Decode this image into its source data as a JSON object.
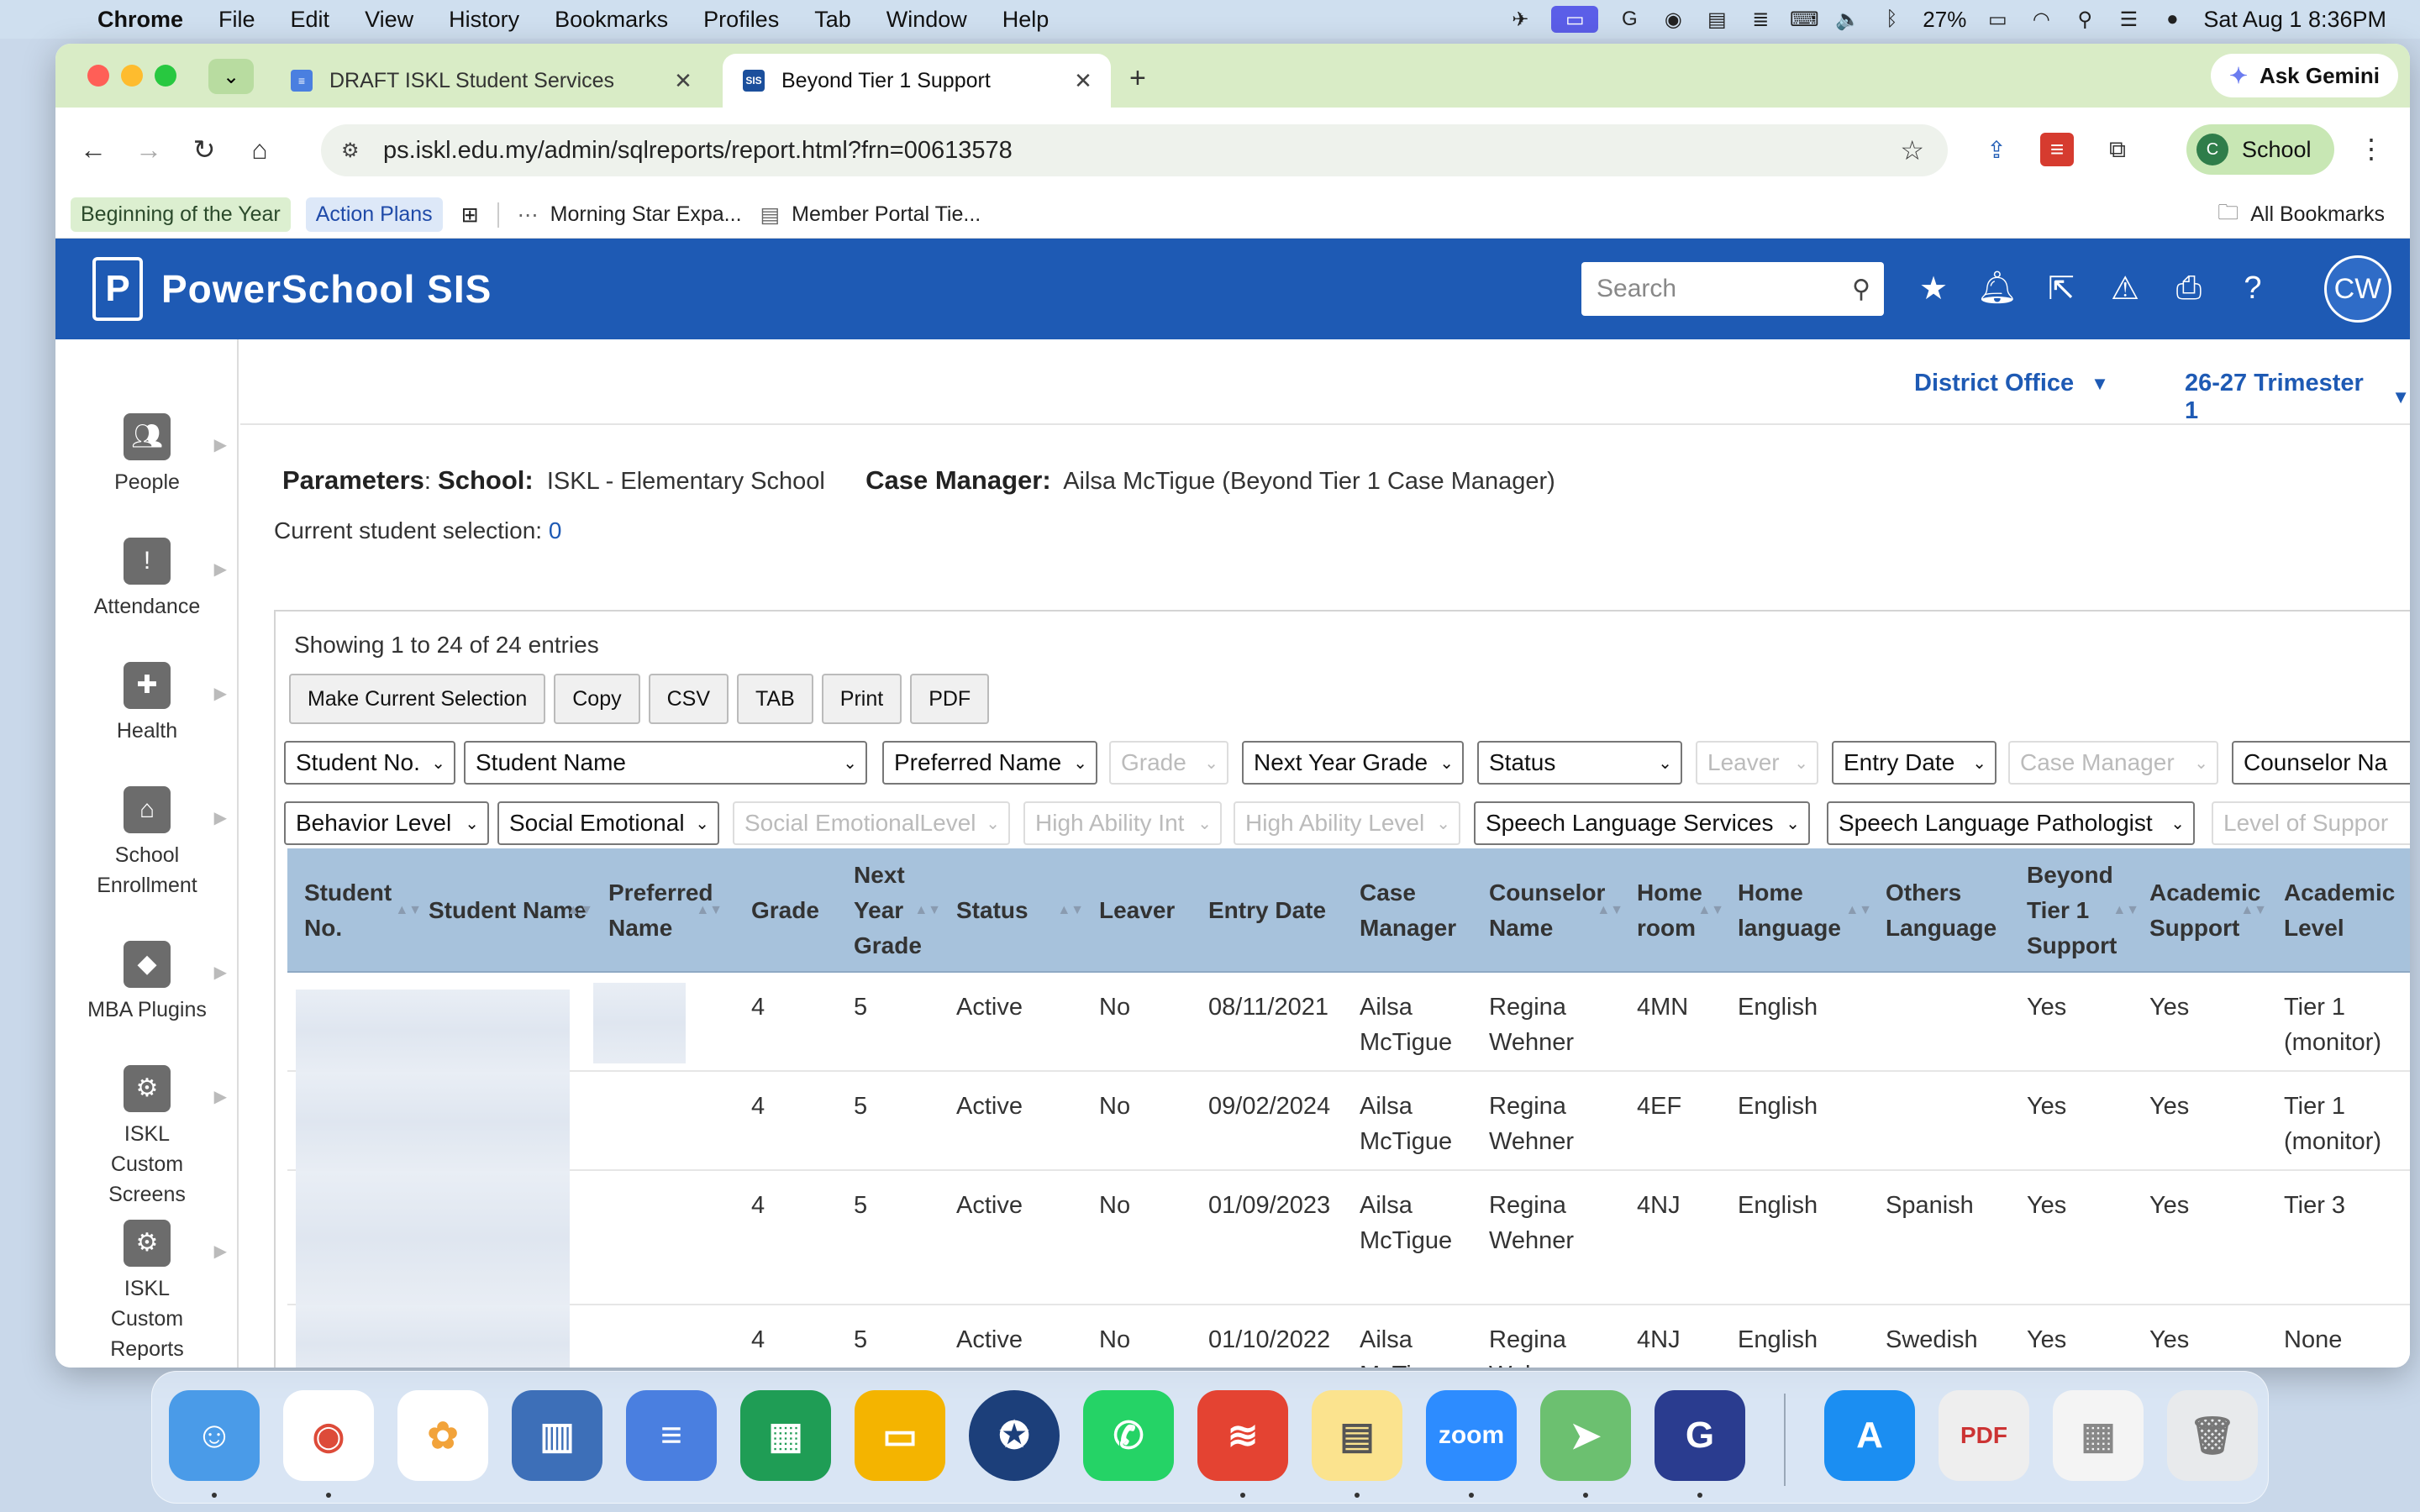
{
  "menubar": {
    "app": "Chrome",
    "items": [
      "File",
      "Edit",
      "View",
      "History",
      "Bookmarks",
      "Profiles",
      "Tab",
      "Window",
      "Help"
    ],
    "battery": "27%",
    "clock": "Sat Aug 1  8:36PM"
  },
  "browser": {
    "tabs": [
      {
        "title": "DRAFT ISKL Student Services",
        "icon": "docs-icon"
      },
      {
        "title": "Beyond Tier 1 Support",
        "icon": "sis-icon"
      }
    ],
    "ask_gemini": "Ask Gemini",
    "url": "ps.iskl.edu.my/admin/sqlreports/report.html?frn=00613578",
    "profile": {
      "initial": "C",
      "label": "School"
    },
    "bookmarks": [
      "Beginning of the Year",
      "Action Plans",
      "Morning Star Expa...",
      "Member Portal Tie..."
    ],
    "all_bookmarks": "All Bookmarks"
  },
  "ps": {
    "title": "PowerSchool SIS",
    "search_placeholder": "Search",
    "avatar": "CW",
    "district": "District Office",
    "term": "26-27 Trimester 1",
    "sidebar": [
      "People",
      "Attendance",
      "Health",
      "School Enrollment",
      "MBA Plugins",
      "ISKL Custom Screens",
      "ISKL Custom Reports"
    ],
    "params": {
      "label": "Parameters",
      "school_label": "School:",
      "school": "ISKL - Elementary School",
      "cm_label": "Case Manager:",
      "case_manager": "Ailsa McTigue (Beyond Tier 1 Case Manager)"
    },
    "selection_label": "Current student selection:",
    "selection_count": "0",
    "showing": "Showing 1 to 24 of 24 entries",
    "buttons": [
      "Make Current Selection",
      "Copy",
      "CSV",
      "TAB",
      "Print",
      "PDF"
    ],
    "filters_row1": [
      "Student No.",
      "Student Name",
      "Preferred Name",
      "Grade",
      "Next Year Grade",
      "Status",
      "Leaver",
      "Entry Date",
      "Case Manager",
      "Counselor Na"
    ],
    "filters_row2": [
      "Behavior Level",
      "Social Emotional",
      "Social EmotionalLevel",
      "High Ability Int",
      "High Ability Level",
      "Speech Language Services",
      "Speech Language Pathologist",
      "Level of Suppor"
    ],
    "headers": [
      "Student No.",
      "Student Name",
      "Preferred Name",
      "Grade",
      "Next Year Grade",
      "Status",
      "Leaver",
      "Entry Date",
      "Case Manager",
      "Counselor Name",
      "Home room",
      "Home language",
      "Others Language",
      "Beyond Tier 1 Support",
      "Academic Support",
      "Academic Level"
    ],
    "rows": [
      {
        "grade": "4",
        "next": "5",
        "status": "Active",
        "leaver": "No",
        "entry": "08/11/2021",
        "cm": "Ailsa McTigue",
        "counselor": "Regina Wehner",
        "room": "4MN",
        "lang": "English",
        "other": "",
        "tier": "Yes",
        "acad": "Yes",
        "level": "Tier 1 (monitor)"
      },
      {
        "grade": "4",
        "next": "5",
        "status": "Active",
        "leaver": "No",
        "entry": "09/02/2024",
        "cm": "Ailsa McTigue",
        "counselor": "Regina Wehner",
        "room": "4EF",
        "lang": "English",
        "other": "",
        "tier": "Yes",
        "acad": "Yes",
        "level": "Tier 1 (monitor)"
      },
      {
        "grade": "4",
        "next": "5",
        "status": "Active",
        "leaver": "No",
        "entry": "01/09/2023",
        "cm": "Ailsa McTigue",
        "counselor": "Regina Wehner",
        "room": "4NJ",
        "lang": "English",
        "other": "Spanish",
        "tier": "Yes",
        "acad": "Yes",
        "level": "Tier 3"
      },
      {
        "grade": "4",
        "next": "5",
        "status": "Active",
        "leaver": "No",
        "entry": "01/10/2022",
        "cm": "Ailsa McTigue",
        "counselor": "Regina Wehner",
        "room": "4NJ",
        "lang": "English",
        "other": "Swedish",
        "tier": "Yes",
        "acad": "Yes",
        "level": "None"
      }
    ]
  },
  "dock": [
    "Finder",
    "Chrome",
    "Photos",
    "Keynote Remote",
    "Docs",
    "Sheets",
    "Slides",
    "ISKL",
    "WhatsApp",
    "Todoist",
    "Notes",
    "Zoom",
    "Maps",
    "Grammarly",
    "App Store",
    "PDF",
    "Screenshot",
    "Trash"
  ],
  "colors": {
    "ps_blue": "#1e5ab4",
    "header_row": "#a7c2dc",
    "tab_bar": "#d9ecc6"
  }
}
